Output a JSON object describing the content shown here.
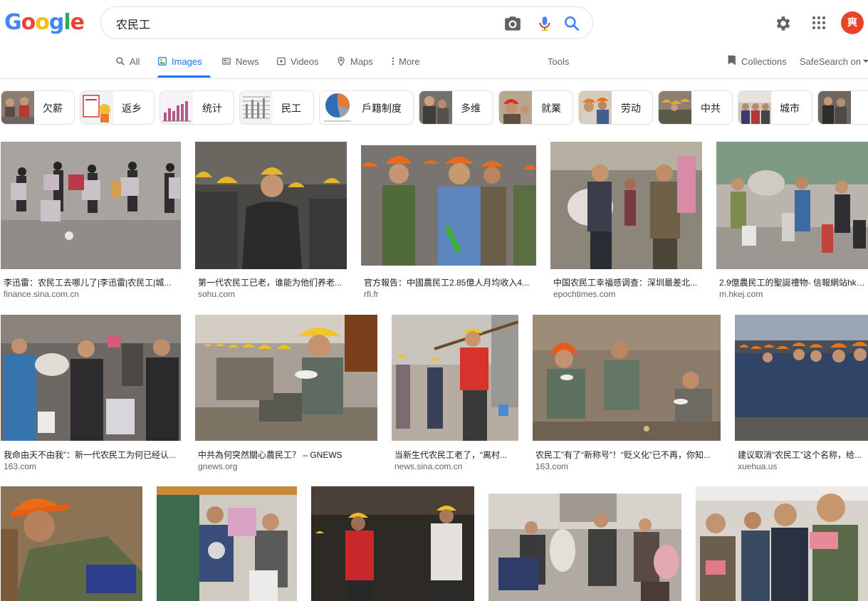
{
  "search": {
    "query": "农民工"
  },
  "logo": {
    "text": "Google"
  },
  "account": {
    "initial": "爽"
  },
  "tabs": [
    {
      "label": "All"
    },
    {
      "label": "Images"
    },
    {
      "label": "News"
    },
    {
      "label": "Videos"
    },
    {
      "label": "Maps"
    },
    {
      "label": "More"
    },
    {
      "label": "Tools"
    }
  ],
  "right_tools": {
    "collections": "Collections",
    "safesearch": "SafeSearch on"
  },
  "chips": [
    {
      "label": "欠薪"
    },
    {
      "label": "返乡"
    },
    {
      "label": "统计"
    },
    {
      "label": "民工"
    },
    {
      "label": "戶籍制度"
    },
    {
      "label": "多维"
    },
    {
      "label": "就業"
    },
    {
      "label": "劳动"
    },
    {
      "label": "中共"
    },
    {
      "label": "城市"
    },
    {
      "label": ""
    }
  ],
  "results": [
    {
      "title": "李迅雷：农民工去哪儿了|李迅雷|农民工|城...",
      "source": "finance.sina.com.cn"
    },
    {
      "title": "第一代农民工已老，谁能为他们养老...",
      "source": "sohu.com"
    },
    {
      "title": "官方報告：中國農民工2.85億人月均收入4...",
      "source": "rfi.fr"
    },
    {
      "title": "中国农民工幸福感调查：深圳最差北...",
      "source": "epochtimes.com"
    },
    {
      "title": "2.9億農民工的聖誕禮物- 信報網站hke...",
      "source": "m.hkej.com"
    },
    {
      "title": "我命由天不由我”：新一代农民工为何已经认...",
      "source": "163.com"
    },
    {
      "title": "中共為何突然關心農民工？ – GNEWS",
      "source": "gnews.org"
    },
    {
      "title": "当新生代农民工老了，“离村...",
      "source": "news.sina.com.cn"
    },
    {
      "title": "农民工”有了“新称号”！“贬义化”已不再，你知...",
      "source": "163.com"
    },
    {
      "title": "建议取消“农民工”这个名称，给...",
      "source": "xuehua.us"
    },
    {
      "title": "",
      "source": ""
    },
    {
      "title": "",
      "source": ""
    },
    {
      "title": "",
      "source": ""
    },
    {
      "title": "",
      "source": ""
    },
    {
      "title": "",
      "source": ""
    }
  ],
  "colors": {
    "accent": "#1a73e8",
    "avatar": "#e8442a",
    "hardhat_orange": "#e8701a",
    "hardhat_yellow": "#f2c12e"
  }
}
